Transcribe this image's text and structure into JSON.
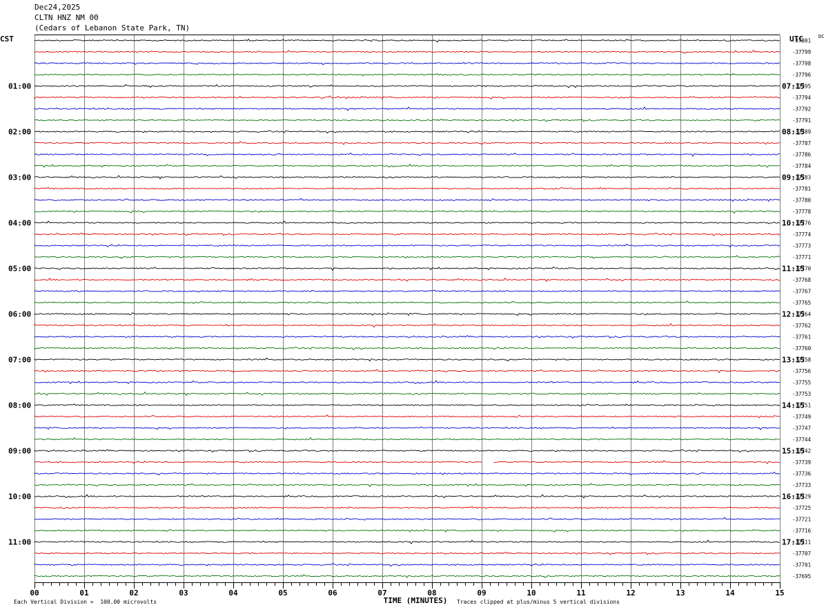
{
  "header": {
    "date": "Dec24,2025",
    "station": "CLTN HNZ NM 00",
    "location": "(Cedars of Lebanon State Park, TN)"
  },
  "left_timezone": "CST",
  "right_timezone": "UTC",
  "right_corner_label": "DC",
  "footer": {
    "scale_note": "Each Vertical Division =  100.00 microvolts",
    "clip_note": "Traces clipped at plus/minus 5 vertical divisions"
  },
  "colors": {
    "trace_cycle": [
      "#000000",
      "#e00000",
      "#0000d0",
      "#007000"
    ],
    "grid": "#808080"
  },
  "chart_data": {
    "type": "line",
    "title": "CLTN HNZ NM 00",
    "xlabel": "TIME (MINUTES)",
    "x_range": [
      0,
      15
    ],
    "x_ticks": [
      "00",
      "01",
      "02",
      "03",
      "04",
      "05",
      "06",
      "07",
      "08",
      "09",
      "10",
      "11",
      "12",
      "13",
      "14",
      "15"
    ],
    "minutes_per_trace": 15,
    "trace_count": 48,
    "left_hour_labels": [
      "01:00",
      "02:00",
      "03:00",
      "04:00",
      "05:00",
      "06:00",
      "07:00",
      "08:00",
      "09:00",
      "10:00",
      "11:00"
    ],
    "right_hour_labels": [
      "07:15",
      "08:15",
      "09:15",
      "10:15",
      "11:15",
      "12:15",
      "13:15",
      "14:15",
      "15:15",
      "16:15",
      "17:15"
    ],
    "dc_offsets": [
      "-37801",
      "-37799",
      "-37798",
      "-37796",
      "-37795",
      "-37794",
      "-37792",
      "-37791",
      "-37789",
      "-37787",
      "-37786",
      "-37784",
      "-37783",
      "-37781",
      "-37780",
      "-37778",
      "-37776",
      "-37774",
      "-37773",
      "-37771",
      "-37770",
      "-37768",
      "-37767",
      "-37765",
      "-37764",
      "-37762",
      "-37761",
      "-37760",
      "-37758",
      "-37756",
      "-37755",
      "-37753",
      "-37751",
      "-37749",
      "-37747",
      "-37744",
      "-37742",
      "-37739",
      "-37736",
      "-37733",
      "-37729",
      "-37725",
      "-37721",
      "-37716",
      "-37711",
      "-37707",
      "-37701",
      "-37695"
    ],
    "gap": {
      "trace_index": 37,
      "from_minute": 9.0,
      "to_minute": 9.25
    }
  }
}
